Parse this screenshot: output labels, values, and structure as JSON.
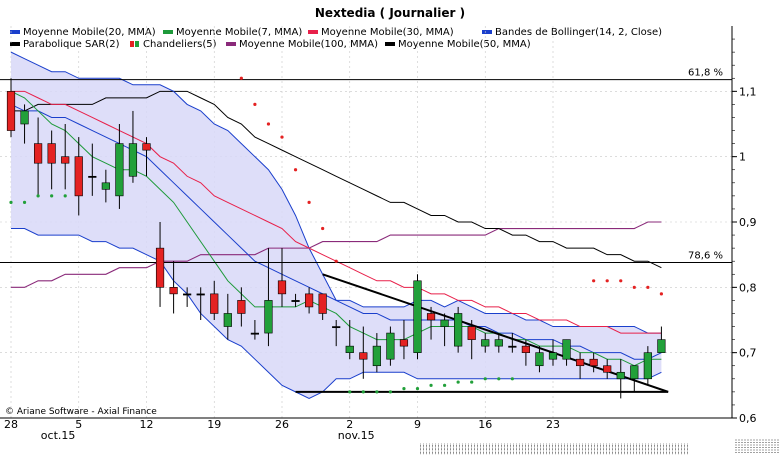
{
  "chart_data": {
    "type": "candlestick",
    "title": "Nextedia  ( Journalier )",
    "copyright": "© Ariane Software - Axial Finance",
    "legend": [
      {
        "name": "Moyenne Mobile(20, MMA)",
        "color": "#1a3fcc"
      },
      {
        "name": "Moyenne Mobile(7, MMA)",
        "color": "#1e9a3a"
      },
      {
        "name": "Moyenne Mobile(30, MMA)",
        "color": "#e8204a"
      },
      {
        "name": "Bandes de Bollinger(14, 2, Close)",
        "color": "#1a3fcc"
      },
      {
        "name": "Parabolique SAR(2)",
        "color": "#000000"
      },
      {
        "name": "Chandeliers(5)",
        "color": "#d22020"
      },
      {
        "name": "Moyenne Mobile(100, MMA)",
        "color": "#8a2a7a"
      },
      {
        "name": "Moyenne Mobile(50, MMA)",
        "color": "#000000"
      }
    ],
    "ylim": [
      0.6,
      1.2
    ],
    "yticks": [
      0.6,
      0.7,
      0.8,
      0.9,
      1,
      1.1
    ],
    "yticklabels": [
      "0,6",
      "0,7",
      "0,8",
      "0,9",
      "1",
      "1,1"
    ],
    "xticks": [
      {
        "i": 0,
        "label": "28"
      },
      {
        "i": 5,
        "label": "5"
      },
      {
        "i": 10,
        "label": "12"
      },
      {
        "i": 15,
        "label": "19"
      },
      {
        "i": 20,
        "label": "26"
      },
      {
        "i": 25,
        "label": "2"
      },
      {
        "i": 30,
        "label": "9"
      },
      {
        "i": 35,
        "label": "16"
      },
      {
        "i": 40,
        "label": "23"
      }
    ],
    "month_labels": [
      {
        "i": 2,
        "label": "oct.15"
      },
      {
        "i": 24,
        "label": "nov.15"
      }
    ],
    "fib_levels": [
      {
        "value": 1.118,
        "label": "61,8 %"
      },
      {
        "value": 0.838,
        "label": "78,6 %"
      }
    ],
    "candles": [
      {
        "o": 1.1,
        "h": 1.12,
        "l": 1.03,
        "c": 1.04
      },
      {
        "o": 1.05,
        "h": 1.08,
        "l": 1.02,
        "c": 1.07
      },
      {
        "o": 1.02,
        "h": 1.06,
        "l": 0.94,
        "c": 0.99
      },
      {
        "o": 1.02,
        "h": 1.04,
        "l": 0.95,
        "c": 0.99
      },
      {
        "o": 1.0,
        "h": 1.05,
        "l": 0.95,
        "c": 0.99
      },
      {
        "o": 1.0,
        "h": 1.03,
        "l": 0.91,
        "c": 0.94
      },
      {
        "o": 0.97,
        "h": 1.02,
        "l": 0.94,
        "c": 0.97
      },
      {
        "o": 0.95,
        "h": 0.98,
        "l": 0.93,
        "c": 0.96
      },
      {
        "o": 0.94,
        "h": 1.05,
        "l": 0.92,
        "c": 1.02
      },
      {
        "o": 0.97,
        "h": 1.07,
        "l": 0.96,
        "c": 1.02
      },
      {
        "o": 1.02,
        "h": 1.03,
        "l": 0.97,
        "c": 1.01
      },
      {
        "o": 0.86,
        "h": 0.9,
        "l": 0.77,
        "c": 0.8
      },
      {
        "o": 0.8,
        "h": 0.84,
        "l": 0.76,
        "c": 0.79
      },
      {
        "o": 0.79,
        "h": 0.8,
        "l": 0.77,
        "c": 0.79
      },
      {
        "o": 0.79,
        "h": 0.8,
        "l": 0.75,
        "c": 0.79
      },
      {
        "o": 0.79,
        "h": 0.81,
        "l": 0.75,
        "c": 0.76
      },
      {
        "o": 0.74,
        "h": 0.79,
        "l": 0.72,
        "c": 0.76
      },
      {
        "o": 0.78,
        "h": 0.8,
        "l": 0.74,
        "c": 0.76
      },
      {
        "o": 0.73,
        "h": 0.75,
        "l": 0.72,
        "c": 0.73
      },
      {
        "o": 0.73,
        "h": 0.86,
        "l": 0.71,
        "c": 0.78
      },
      {
        "o": 0.81,
        "h": 0.86,
        "l": 0.77,
        "c": 0.79
      },
      {
        "o": 0.78,
        "h": 0.79,
        "l": 0.77,
        "c": 0.78
      },
      {
        "o": 0.79,
        "h": 0.8,
        "l": 0.76,
        "c": 0.77
      },
      {
        "o": 0.79,
        "h": 0.79,
        "l": 0.75,
        "c": 0.76
      },
      {
        "o": 0.74,
        "h": 0.75,
        "l": 0.71,
        "c": 0.74
      },
      {
        "o": 0.7,
        "h": 0.75,
        "l": 0.69,
        "c": 0.71
      },
      {
        "o": 0.7,
        "h": 0.74,
        "l": 0.66,
        "c": 0.69
      },
      {
        "o": 0.68,
        "h": 0.73,
        "l": 0.67,
        "c": 0.71
      },
      {
        "o": 0.69,
        "h": 0.74,
        "l": 0.68,
        "c": 0.73
      },
      {
        "o": 0.72,
        "h": 0.75,
        "l": 0.69,
        "c": 0.71
      },
      {
        "o": 0.7,
        "h": 0.82,
        "l": 0.69,
        "c": 0.81
      },
      {
        "o": 0.76,
        "h": 0.77,
        "l": 0.72,
        "c": 0.75
      },
      {
        "o": 0.74,
        "h": 0.76,
        "l": 0.71,
        "c": 0.75
      },
      {
        "o": 0.71,
        "h": 0.77,
        "l": 0.7,
        "c": 0.76
      },
      {
        "o": 0.74,
        "h": 0.75,
        "l": 0.69,
        "c": 0.72
      },
      {
        "o": 0.71,
        "h": 0.73,
        "l": 0.7,
        "c": 0.72
      },
      {
        "o": 0.71,
        "h": 0.73,
        "l": 0.7,
        "c": 0.72
      },
      {
        "o": 0.71,
        "h": 0.73,
        "l": 0.7,
        "c": 0.71
      },
      {
        "o": 0.71,
        "h": 0.72,
        "l": 0.68,
        "c": 0.7
      },
      {
        "o": 0.68,
        "h": 0.71,
        "l": 0.67,
        "c": 0.7
      },
      {
        "o": 0.69,
        "h": 0.72,
        "l": 0.68,
        "c": 0.7
      },
      {
        "o": 0.69,
        "h": 0.72,
        "l": 0.68,
        "c": 0.72
      },
      {
        "o": 0.69,
        "h": 0.7,
        "l": 0.66,
        "c": 0.68
      },
      {
        "o": 0.69,
        "h": 0.7,
        "l": 0.67,
        "c": 0.68
      },
      {
        "o": 0.68,
        "h": 0.69,
        "l": 0.66,
        "c": 0.67
      },
      {
        "o": 0.66,
        "h": 0.69,
        "l": 0.63,
        "c": 0.67
      },
      {
        "o": 0.66,
        "h": 0.68,
        "l": 0.64,
        "c": 0.68
      },
      {
        "o": 0.66,
        "h": 0.71,
        "l": 0.65,
        "c": 0.7
      },
      {
        "o": 0.7,
        "h": 0.74,
        "l": 0.7,
        "c": 0.72
      }
    ],
    "bollinger_upper": [
      1.16,
      1.15,
      1.14,
      1.13,
      1.13,
      1.12,
      1.12,
      1.12,
      1.12,
      1.11,
      1.11,
      1.11,
      1.1,
      1.08,
      1.07,
      1.05,
      1.04,
      1.02,
      1.0,
      0.98,
      0.95,
      0.91,
      0.86,
      0.82,
      0.78,
      0.78,
      0.77,
      0.77,
      0.77,
      0.77,
      0.78,
      0.78,
      0.77,
      0.78,
      0.77,
      0.76,
      0.76,
      0.76,
      0.75,
      0.75,
      0.74,
      0.74,
      0.74,
      0.74,
      0.74,
      0.74,
      0.74,
      0.73,
      0.73
    ],
    "bollinger_lower": [
      0.89,
      0.89,
      0.88,
      0.88,
      0.88,
      0.88,
      0.87,
      0.87,
      0.86,
      0.86,
      0.85,
      0.84,
      0.81,
      0.79,
      0.76,
      0.74,
      0.72,
      0.71,
      0.69,
      0.67,
      0.65,
      0.64,
      0.63,
      0.64,
      0.66,
      0.66,
      0.67,
      0.67,
      0.67,
      0.67,
      0.66,
      0.66,
      0.66,
      0.66,
      0.66,
      0.66,
      0.66,
      0.66,
      0.66,
      0.66,
      0.66,
      0.66,
      0.66,
      0.66,
      0.66,
      0.66,
      0.66,
      0.66,
      0.67
    ],
    "mm7": [
      1.1,
      1.09,
      1.07,
      1.05,
      1.04,
      1.02,
      1.0,
      0.99,
      0.98,
      0.98,
      0.97,
      0.95,
      0.93,
      0.9,
      0.87,
      0.84,
      0.81,
      0.79,
      0.77,
      0.77,
      0.77,
      0.77,
      0.78,
      0.77,
      0.76,
      0.74,
      0.73,
      0.72,
      0.72,
      0.72,
      0.73,
      0.74,
      0.74,
      0.74,
      0.74,
      0.73,
      0.73,
      0.72,
      0.72,
      0.71,
      0.71,
      0.71,
      0.7,
      0.7,
      0.69,
      0.69,
      0.68,
      0.69,
      0.69
    ],
    "mm20": [
      1.08,
      1.07,
      1.07,
      1.06,
      1.06,
      1.05,
      1.04,
      1.03,
      1.02,
      1.01,
      1.0,
      0.98,
      0.96,
      0.94,
      0.92,
      0.9,
      0.88,
      0.86,
      0.84,
      0.83,
      0.82,
      0.81,
      0.8,
      0.79,
      0.78,
      0.77,
      0.76,
      0.76,
      0.75,
      0.75,
      0.75,
      0.75,
      0.75,
      0.75,
      0.74,
      0.74,
      0.73,
      0.73,
      0.72,
      0.72,
      0.72,
      0.71,
      0.71,
      0.7,
      0.7,
      0.7,
      0.69,
      0.69,
      0.7
    ],
    "mm30": [
      1.1,
      1.1,
      1.09,
      1.08,
      1.08,
      1.07,
      1.06,
      1.05,
      1.04,
      1.03,
      1.02,
      1.0,
      0.99,
      0.97,
      0.96,
      0.94,
      0.93,
      0.92,
      0.91,
      0.9,
      0.89,
      0.87,
      0.86,
      0.85,
      0.84,
      0.83,
      0.82,
      0.81,
      0.81,
      0.8,
      0.8,
      0.79,
      0.79,
      0.78,
      0.78,
      0.77,
      0.77,
      0.76,
      0.76,
      0.75,
      0.75,
      0.75,
      0.74,
      0.74,
      0.74,
      0.73,
      0.73,
      0.73,
      0.73
    ],
    "mm50": [
      1.07,
      1.07,
      1.08,
      1.08,
      1.08,
      1.08,
      1.08,
      1.09,
      1.09,
      1.09,
      1.09,
      1.1,
      1.1,
      1.1,
      1.09,
      1.08,
      1.06,
      1.05,
      1.03,
      1.02,
      1.01,
      1.0,
      0.99,
      0.98,
      0.97,
      0.96,
      0.95,
      0.94,
      0.93,
      0.93,
      0.92,
      0.91,
      0.91,
      0.9,
      0.9,
      0.89,
      0.89,
      0.88,
      0.88,
      0.87,
      0.87,
      0.86,
      0.86,
      0.86,
      0.85,
      0.85,
      0.84,
      0.84,
      0.83
    ],
    "mm100": [
      0.8,
      0.8,
      0.81,
      0.81,
      0.82,
      0.82,
      0.82,
      0.82,
      0.83,
      0.83,
      0.83,
      0.84,
      0.84,
      0.84,
      0.85,
      0.85,
      0.85,
      0.85,
      0.85,
      0.86,
      0.86,
      0.86,
      0.86,
      0.87,
      0.87,
      0.87,
      0.87,
      0.87,
      0.88,
      0.88,
      0.88,
      0.88,
      0.88,
      0.88,
      0.88,
      0.88,
      0.89,
      0.89,
      0.89,
      0.89,
      0.89,
      0.89,
      0.89,
      0.89,
      0.89,
      0.89,
      0.89,
      0.9,
      0.9
    ],
    "sar": [
      {
        "i": 0,
        "v": 0.93,
        "pos": "below"
      },
      {
        "i": 1,
        "v": 0.93,
        "pos": "below"
      },
      {
        "i": 2,
        "v": 0.94,
        "pos": "below"
      },
      {
        "i": 3,
        "v": 0.94,
        "pos": "below"
      },
      {
        "i": 4,
        "v": 0.94,
        "pos": "below"
      },
      {
        "i": 17,
        "v": 1.12,
        "pos": "above"
      },
      {
        "i": 18,
        "v": 1.08,
        "pos": "above"
      },
      {
        "i": 19,
        "v": 1.05,
        "pos": "above"
      },
      {
        "i": 20,
        "v": 1.03,
        "pos": "above"
      },
      {
        "i": 21,
        "v": 0.98,
        "pos": "above"
      },
      {
        "i": 22,
        "v": 0.93,
        "pos": "above"
      },
      {
        "i": 23,
        "v": 0.89,
        "pos": "above"
      },
      {
        "i": 24,
        "v": 0.84,
        "pos": "above"
      },
      {
        "i": 25,
        "v": 0.64,
        "pos": "below"
      },
      {
        "i": 26,
        "v": 0.64,
        "pos": "below"
      },
      {
        "i": 27,
        "v": 0.64,
        "pos": "below"
      },
      {
        "i": 28,
        "v": 0.64,
        "pos": "below"
      },
      {
        "i": 29,
        "v": 0.645,
        "pos": "below"
      },
      {
        "i": 30,
        "v": 0.645,
        "pos": "below"
      },
      {
        "i": 31,
        "v": 0.65,
        "pos": "below"
      },
      {
        "i": 32,
        "v": 0.65,
        "pos": "below"
      },
      {
        "i": 33,
        "v": 0.655,
        "pos": "below"
      },
      {
        "i": 34,
        "v": 0.655,
        "pos": "below"
      },
      {
        "i": 35,
        "v": 0.66,
        "pos": "below"
      },
      {
        "i": 36,
        "v": 0.66,
        "pos": "below"
      },
      {
        "i": 37,
        "v": 0.66,
        "pos": "below"
      },
      {
        "i": 43,
        "v": 0.81,
        "pos": "above"
      },
      {
        "i": 44,
        "v": 0.81,
        "pos": "above"
      },
      {
        "i": 45,
        "v": 0.81,
        "pos": "above"
      },
      {
        "i": 46,
        "v": 0.8,
        "pos": "above"
      },
      {
        "i": 47,
        "v": 0.8,
        "pos": "above"
      },
      {
        "i": 48,
        "v": 0.79,
        "pos": "above"
      }
    ],
    "trendlines": [
      {
        "i1": 23,
        "v1": 0.82,
        "i2": 48.5,
        "v2": 0.64
      },
      {
        "i1": 21,
        "v1": 0.64,
        "i2": 48.5,
        "v2": 0.64
      }
    ],
    "colors": {
      "up": "#22a03a",
      "down": "#e42222",
      "band_fill": "#d8d8f8",
      "grid": "#c8c8c8"
    }
  }
}
